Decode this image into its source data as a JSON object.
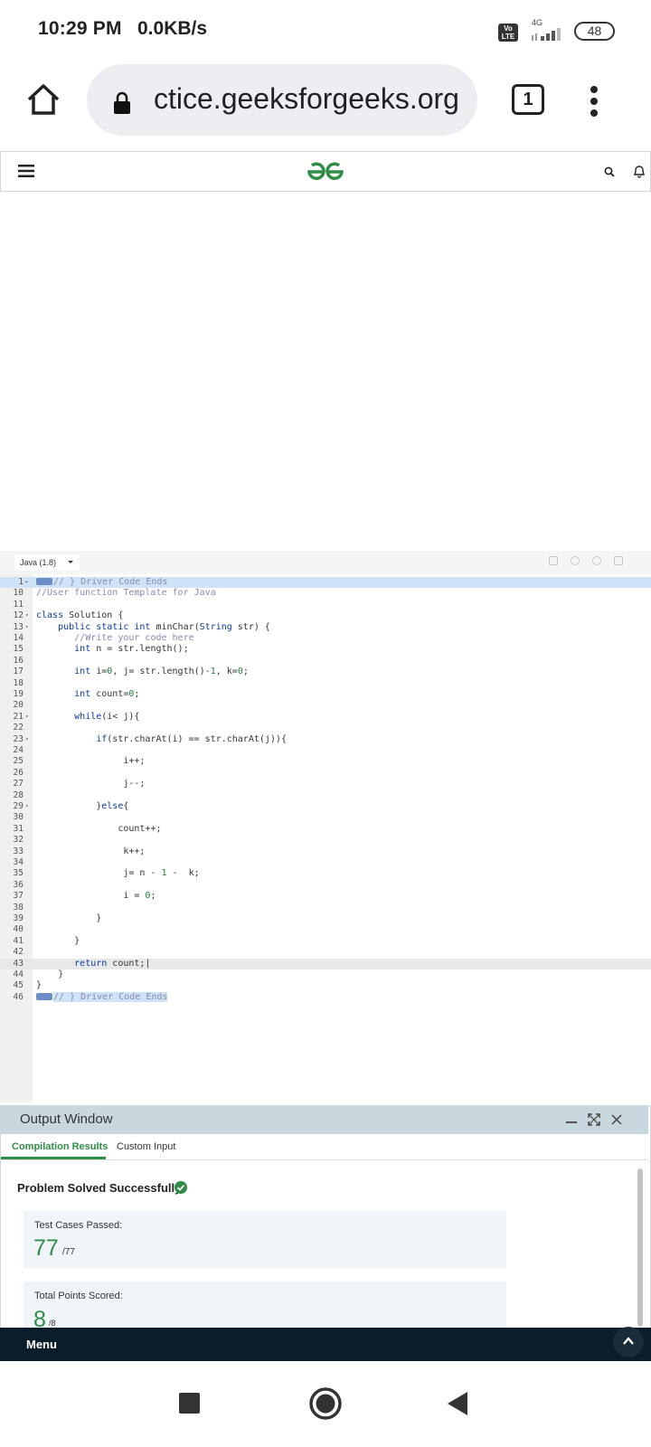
{
  "status_bar": {
    "time": "10:29 PM",
    "net_speed": "0.0KB/s",
    "volte": "Vo\nLTE",
    "network_type": "4G",
    "battery": "48"
  },
  "browser": {
    "url": "ctice.geeksforgeeks.org",
    "tab_count": "1"
  },
  "editor": {
    "language": "Java (1.8)",
    "lines": [
      {
        "num": "1",
        "fold": "▸",
        "parts": [
          [
            "pill",
            ""
          ],
          [
            "cm",
            "// } Driver Code Ends"
          ]
        ],
        "hl": "top"
      },
      {
        "num": "10",
        "parts": [
          [
            "cm",
            "//User function Template for Java"
          ]
        ]
      },
      {
        "num": "11",
        "parts": []
      },
      {
        "num": "12",
        "fold": "▾",
        "parts": [
          [
            "kw",
            "class"
          ],
          [
            "t",
            " Solution {"
          ]
        ]
      },
      {
        "num": "13",
        "fold": "▾",
        "parts": [
          [
            "t",
            "    "
          ],
          [
            "kw",
            "public static int"
          ],
          [
            "t",
            " minChar("
          ],
          [
            "kw",
            "String"
          ],
          [
            "t",
            " str) {"
          ]
        ]
      },
      {
        "num": "14",
        "parts": [
          [
            "t",
            "       "
          ],
          [
            "cm",
            "//Write your code here"
          ]
        ]
      },
      {
        "num": "15",
        "parts": [
          [
            "t",
            "       "
          ],
          [
            "kw",
            "int"
          ],
          [
            "t",
            " n = str.length();"
          ]
        ]
      },
      {
        "num": "16",
        "parts": []
      },
      {
        "num": "17",
        "parts": [
          [
            "t",
            "       "
          ],
          [
            "kw",
            "int"
          ],
          [
            "t",
            " i="
          ],
          [
            "num",
            "0"
          ],
          [
            "t",
            ", j= str.length()-"
          ],
          [
            "num",
            "1"
          ],
          [
            "t",
            ", k="
          ],
          [
            "num",
            "0"
          ],
          [
            "t",
            ";"
          ]
        ]
      },
      {
        "num": "18",
        "parts": []
      },
      {
        "num": "19",
        "parts": [
          [
            "t",
            "       "
          ],
          [
            "kw",
            "int"
          ],
          [
            "t",
            " count="
          ],
          [
            "num",
            "0"
          ],
          [
            "t",
            ";"
          ]
        ]
      },
      {
        "num": "20",
        "parts": []
      },
      {
        "num": "21",
        "fold": "▾",
        "parts": [
          [
            "t",
            "       "
          ],
          [
            "kw",
            "while"
          ],
          [
            "t",
            "(i< j){"
          ]
        ]
      },
      {
        "num": "22",
        "parts": []
      },
      {
        "num": "23",
        "fold": "▾",
        "parts": [
          [
            "t",
            "           "
          ],
          [
            "kw",
            "if"
          ],
          [
            "t",
            "(str.charAt(i) == str.charAt(j)){"
          ]
        ]
      },
      {
        "num": "24",
        "parts": []
      },
      {
        "num": "25",
        "parts": [
          [
            "t",
            "                "
          ],
          [
            "t",
            "i++;"
          ]
        ]
      },
      {
        "num": "26",
        "parts": []
      },
      {
        "num": "27",
        "parts": [
          [
            "t",
            "                "
          ],
          [
            "t",
            "j--;"
          ]
        ]
      },
      {
        "num": "28",
        "parts": []
      },
      {
        "num": "29",
        "fold": "▾",
        "parts": [
          [
            "t",
            "           "
          ],
          [
            "t",
            "}"
          ],
          [
            "kw",
            "else"
          ],
          [
            "t",
            "{"
          ]
        ]
      },
      {
        "num": "30",
        "parts": []
      },
      {
        "num": "31",
        "parts": [
          [
            "t",
            "               "
          ],
          [
            "t",
            "count++;"
          ]
        ]
      },
      {
        "num": "32",
        "parts": []
      },
      {
        "num": "33",
        "parts": [
          [
            "t",
            "                "
          ],
          [
            "t",
            "k++;"
          ]
        ]
      },
      {
        "num": "34",
        "parts": []
      },
      {
        "num": "35",
        "parts": [
          [
            "t",
            "                "
          ],
          [
            "t",
            "j= n - "
          ],
          [
            "num",
            "1"
          ],
          [
            "t",
            " -  k;"
          ]
        ]
      },
      {
        "num": "36",
        "parts": []
      },
      {
        "num": "37",
        "parts": [
          [
            "t",
            "                "
          ],
          [
            "t",
            "i = "
          ],
          [
            "num",
            "0"
          ],
          [
            "t",
            ";"
          ]
        ]
      },
      {
        "num": "38",
        "parts": []
      },
      {
        "num": "39",
        "parts": [
          [
            "t",
            "           "
          ],
          [
            "t",
            "}"
          ]
        ]
      },
      {
        "num": "40",
        "parts": []
      },
      {
        "num": "41",
        "parts": [
          [
            "t",
            "       "
          ],
          [
            "t",
            "}"
          ]
        ]
      },
      {
        "num": "42",
        "parts": []
      },
      {
        "num": "43",
        "parts": [
          [
            "t",
            "       "
          ],
          [
            "kw",
            "return"
          ],
          [
            "t",
            " count;|"
          ]
        ],
        "hl": "cur"
      },
      {
        "num": "44",
        "parts": [
          [
            "t",
            "    }"
          ]
        ]
      },
      {
        "num": "45",
        "parts": [
          [
            "t",
            "}"
          ]
        ]
      },
      {
        "num": "46",
        "parts": [
          [
            "pill",
            ""
          ],
          [
            "sel",
            "// } Driver Code Ends"
          ]
        ]
      }
    ]
  },
  "output": {
    "title": "Output Window",
    "tabs": [
      "Compilation Results",
      "Custom Input"
    ],
    "status": "Problem Solved Successfully",
    "tests_label": "Test Cases Passed:",
    "tests_passed": "77",
    "tests_total": "/77",
    "points_label": "Total Points Scored:",
    "points": "8",
    "points_total": "/8"
  },
  "menu_bar": {
    "label": "Menu"
  },
  "colors": {
    "accent": "#2f8d46",
    "menu_bar": "#0b1c2b",
    "output_header": "#c8d8de"
  },
  "icons": [
    "home-icon",
    "lock-icon",
    "tabs-icon",
    "overflow-menu-icon",
    "hamburger-icon",
    "gfg-logo",
    "search-icon",
    "bell-icon",
    "minimize-icon",
    "expand-icon",
    "close-icon",
    "check-icon",
    "chevron-up-icon"
  ]
}
